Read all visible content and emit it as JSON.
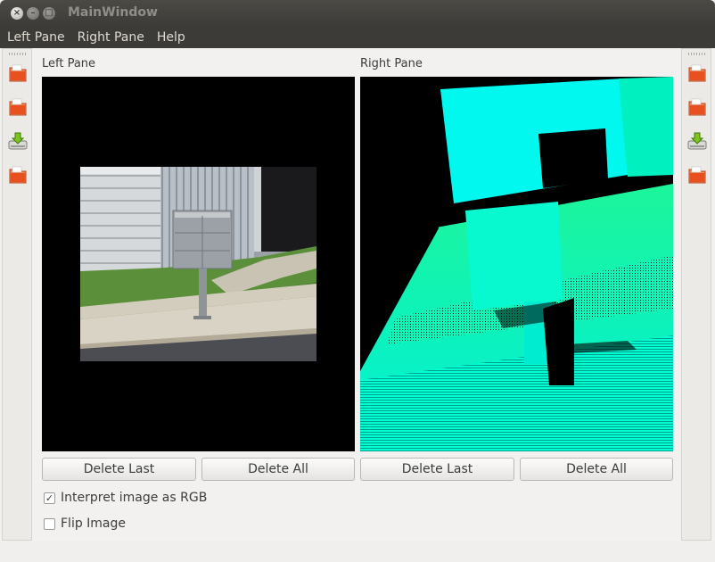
{
  "window": {
    "title": "MainWindow"
  },
  "menu": [
    "Left Pane",
    "Right Pane",
    "Help"
  ],
  "left_toolbar": [
    "open-icon",
    "open-icon",
    "save-icon",
    "open-icon"
  ],
  "right_toolbar": [
    "open-icon",
    "open-icon",
    "save-icon",
    "open-icon"
  ],
  "panes": {
    "left": {
      "label": "Left Pane",
      "delete_last": "Delete Last",
      "delete_all": "Delete All"
    },
    "right": {
      "label": "Right Pane",
      "delete_last": "Delete Last",
      "delete_all": "Delete All"
    }
  },
  "options": {
    "interpret_rgb": {
      "label": "Interpret image as RGB",
      "checked": true
    },
    "flip_image": {
      "label": "Flip Image",
      "checked": false
    }
  },
  "colors": {
    "titlebar": "#3c3b37",
    "depth_cyan": "#00ffd0",
    "depth_green": "#00f0a0"
  }
}
